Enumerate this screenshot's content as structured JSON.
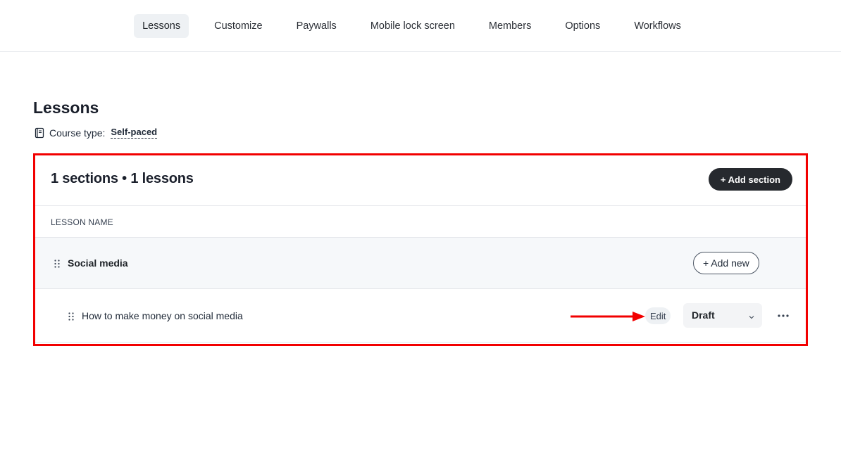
{
  "nav": {
    "tabs": [
      {
        "label": "Lessons"
      },
      {
        "label": "Customize"
      },
      {
        "label": "Paywalls"
      },
      {
        "label": "Mobile lock screen"
      },
      {
        "label": "Members"
      },
      {
        "label": "Options"
      },
      {
        "label": "Workflows"
      }
    ],
    "active_tab": "Lessons"
  },
  "page": {
    "title": "Lessons",
    "course_type_label": "Course type:",
    "course_type_value": "Self-paced",
    "course_type_icon": "book-icon"
  },
  "panel": {
    "summary": "1 sections • 1 lessons",
    "add_section_label": "+ Add section",
    "column_header": "LESSON NAME",
    "highlight_color": "#f20000"
  },
  "section": {
    "name": "Social media",
    "add_new_label": "+ Add new",
    "drag_icon": "drag-handle-icon"
  },
  "lesson": {
    "name": "How to make money on social media",
    "edit_label": "Edit",
    "status": "Draft",
    "status_icon": "chevron-down-icon",
    "more_icon": "more-horizontal-icon",
    "annotation_icon": "red-arrow-icon"
  },
  "colors": {
    "primary_button": "#26292e",
    "annotation": "#f20000",
    "active_tab_bg": "#eef1f4"
  }
}
